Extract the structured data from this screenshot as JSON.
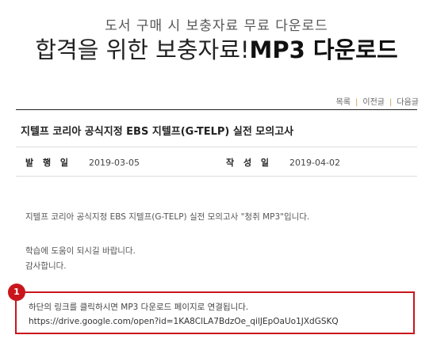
{
  "banner": {
    "subheading": "도서 구매 시 보충자료 무료 다운로드",
    "headline_prefix": "합격을 위한 보충자료!",
    "headline_strong": "MP3 다운로드"
  },
  "nav": {
    "list_label": "목록",
    "prev_label": "이전글",
    "next_label": "다음글",
    "separator": "|"
  },
  "post": {
    "title": "지텔프 코리아 공식지정 EBS 지텔프(G-TELP) 실전 모의고사",
    "published_label": "발 행 일",
    "published_value": "2019-03-05",
    "written_label": "작 성 일",
    "written_value": "2019-04-02",
    "body_line1": "지텔프 코리아 공식지정 EBS 지텔프(G-TELP) 실전 모의고사  \"청취 MP3\"입니다.",
    "body_line2": "학습에 도움이 되시길 바랍니다.",
    "body_line3": "감사합니다."
  },
  "download": {
    "badge_number": "1",
    "caption": "하단의 링크를 클릭하시면 MP3 다운로드 페이지로 연결됩니다.",
    "url": "https://drive.google.com/open?id=1KA8ClLA7BdzOe_qilJEpOaUo1JXdGSKQ"
  },
  "colors": {
    "accent_red": "#c9161d",
    "separator_gold": "#c9a24a"
  }
}
